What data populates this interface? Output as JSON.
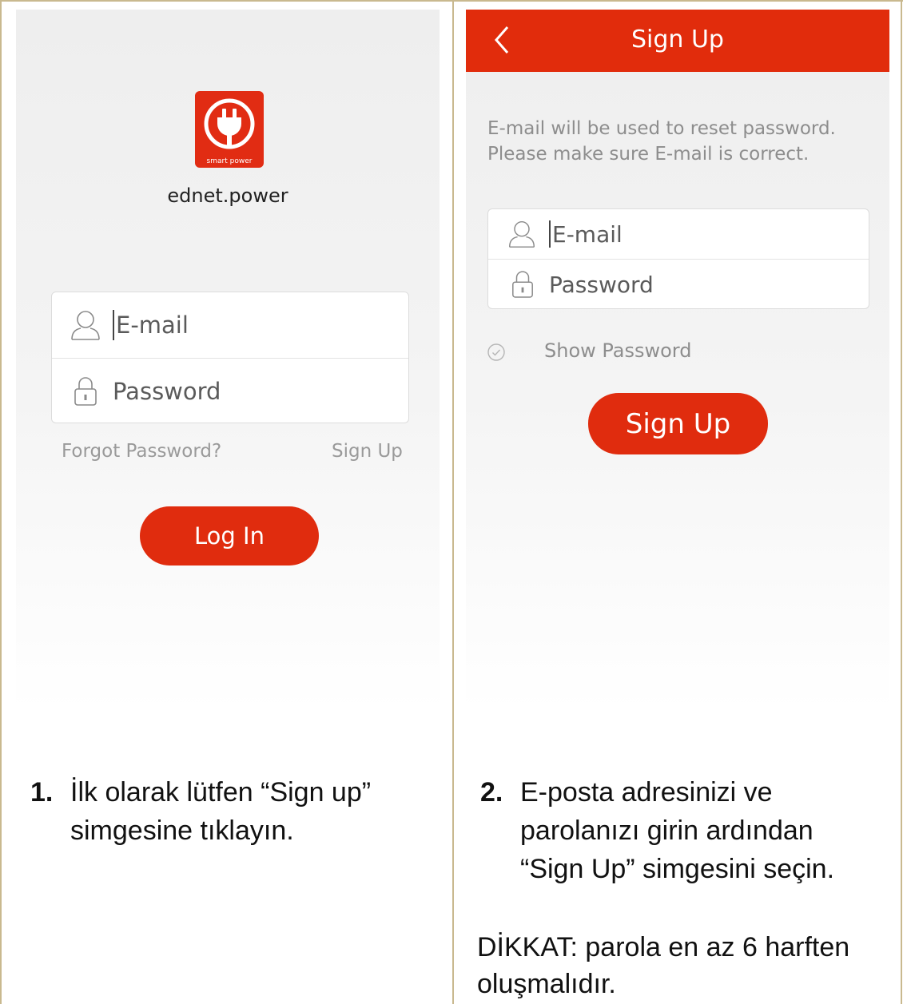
{
  "left_screen": {
    "brand_text": "smart power",
    "app_name": "ednet.power",
    "email_placeholder": "E-mail",
    "password_placeholder": "Password",
    "forgot_password": "Forgot Password?",
    "sign_up_link": "Sign Up",
    "login_button": "Log In",
    "icons": [
      "plug-logo-icon",
      "user-icon",
      "lock-icon"
    ]
  },
  "right_screen": {
    "header_title": "Sign Up",
    "notice": "E-mail will be used to reset password. Please make sure E-mail is correct.",
    "email_placeholder": "E-mail",
    "password_placeholder": "Password",
    "show_password": "Show Password",
    "signup_button": "Sign Up",
    "icons": [
      "back-chevron-icon",
      "user-icon",
      "lock-icon",
      "check-circle-icon"
    ]
  },
  "captions": {
    "step1_number": "1.",
    "step1_line1": "İlk olarak lütfen “Sign up”",
    "step1_line2": "simgesine tıklayın.",
    "step2_number": "2.",
    "step2_line1": "E-posta adresinizi ve",
    "step2_line2": "parolanızı girin ardından",
    "step2_line3": "“Sign Up” simgesini seçin.",
    "warning_line1": "DİKKAT: parola en az 6 harften",
    "warning_line2": "oluşmalıdır."
  },
  "colors": {
    "brand_red": "#e12c0c",
    "frame": "#c9b98f",
    "muted_text": "#8d8d8d"
  }
}
